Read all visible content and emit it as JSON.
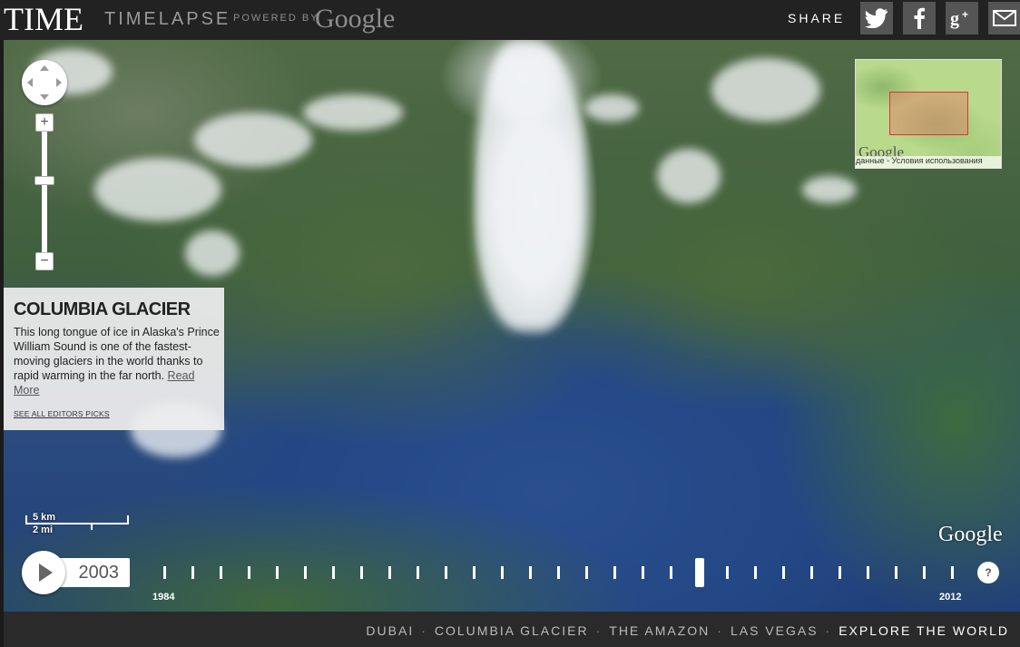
{
  "header": {
    "time_logo": "TIME",
    "timelapse": "TIMELAPSE",
    "powered_by": "POWERED BY",
    "google": "Google",
    "share_label": "SHARE",
    "share_buttons": [
      "twitter-icon",
      "facebook-icon",
      "google-plus-icon",
      "email-icon"
    ]
  },
  "map": {
    "zoom_in_label": "+",
    "zoom_out_label": "−",
    "minimap": {
      "google": "Google",
      "terms": "данные - Условия использования"
    },
    "scale": {
      "km": "5 km",
      "mi": "2 mi"
    },
    "google_watermark": "Google"
  },
  "info": {
    "title": "COLUMBIA GLACIER",
    "description": "This long tongue of ice in Alaska's Prince William Sound is one of the fastest-moving glaciers in the world thanks to rapid warming in the far north.",
    "read_more": "Read More",
    "editors_link": "SEE ALL EDITORS PICKS"
  },
  "timeline": {
    "current_year": "2003",
    "start_year": "1984",
    "end_year": "2012",
    "years": [
      1984,
      1985,
      1986,
      1987,
      1988,
      1989,
      1990,
      1991,
      1992,
      1993,
      1994,
      1995,
      1996,
      1997,
      1998,
      1999,
      2000,
      2001,
      2002,
      2003,
      2004,
      2005,
      2006,
      2007,
      2008,
      2009,
      2010,
      2011,
      2012
    ],
    "help": "?"
  },
  "footer": {
    "links": [
      "DUBAI",
      "COLUMBIA GLACIER",
      "THE AMAZON",
      "LAS VEGAS",
      "EXPLORE THE WORLD"
    ],
    "active": "EXPLORE THE WORLD"
  },
  "colors": {
    "header_bg": "#222222",
    "footer_bg": "#2a2a2a",
    "ocean": "#234784",
    "land": "#3f5f3e"
  }
}
